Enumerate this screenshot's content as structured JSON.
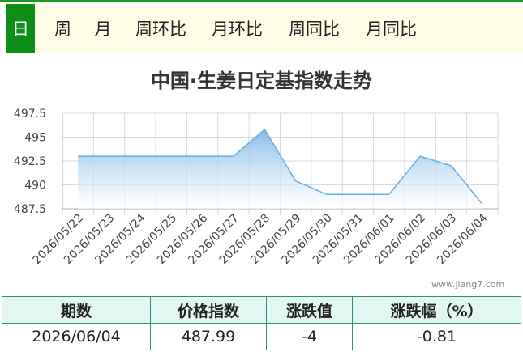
{
  "tabs": [
    {
      "label": "日",
      "active": true
    },
    {
      "label": "周",
      "active": false
    },
    {
      "label": "月",
      "active": false
    },
    {
      "label": "周环比",
      "active": false
    },
    {
      "label": "月环比",
      "active": false
    },
    {
      "label": "周同比",
      "active": false
    },
    {
      "label": "月同比",
      "active": false
    }
  ],
  "watermark": "www.jiang7.com",
  "colors": {
    "accent_green": "#0d8f17",
    "tab_bg": "#fffde6",
    "line": "#6aaee0",
    "area_top": "#8cc2ec",
    "table_border": "#2f8f7f",
    "table_header_bg": "#e2f6f2"
  },
  "chart_data": {
    "type": "area",
    "title": "中国·生姜日定基指数走势",
    "x": [
      "2026/05/22",
      "2026/05/23",
      "2026/05/24",
      "2026/05/25",
      "2026/05/26",
      "2026/05/27",
      "2026/05/28",
      "2026/05/29",
      "2026/05/30",
      "2026/05/31",
      "2026/06/01",
      "2026/06/02",
      "2026/06/03",
      "2026/06/04"
    ],
    "values": [
      493.0,
      493.0,
      493.0,
      493.0,
      493.0,
      493.0,
      495.8,
      490.4,
      489.0,
      489.0,
      489.0,
      493.0,
      492.0,
      487.99
    ],
    "yticks": [
      "497.5",
      "495",
      "492.5",
      "490",
      "487.5"
    ],
    "ylim": [
      487.5,
      497.5
    ],
    "grid": true
  },
  "summary": {
    "headers": [
      "期数",
      "价格指数",
      "涨跌值",
      "涨跌幅（%）"
    ],
    "row": [
      "2026/06/04",
      "487.99",
      "-4",
      "-0.81"
    ]
  }
}
